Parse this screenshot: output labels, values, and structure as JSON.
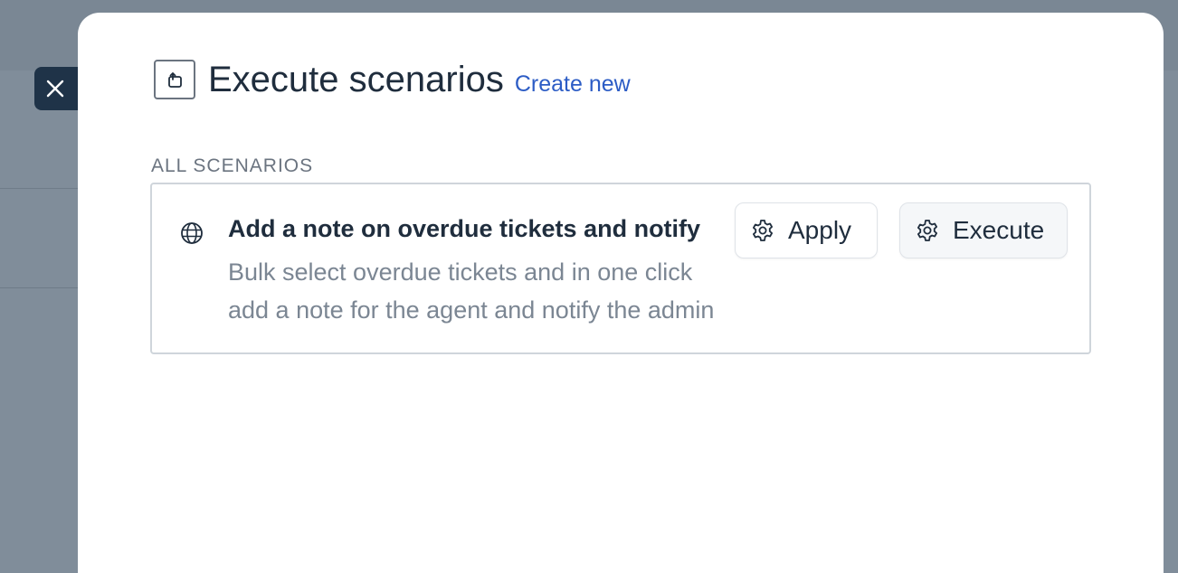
{
  "modal": {
    "title": "Execute scenarios",
    "create_new_label": "Create new",
    "section_label": "ALL SCENARIOS"
  },
  "scenarios": [
    {
      "title": "Add a note on overdue tickets and notify",
      "description": "Bulk select overdue tickets and in one click add a note for the agent and notify the admin as well",
      "apply_label": "Apply",
      "execute_label": "Execute"
    }
  ],
  "icons": {
    "close": "close-icon",
    "header": "scenario-automation-icon",
    "scope": "globe-icon",
    "apply": "gear-icon",
    "execute": "gear-icon"
  },
  "colors": {
    "overlay": "#808d9a",
    "close_button": "#1f3348",
    "title_text": "#1f2d3d",
    "link": "#2c5cc5",
    "muted_text": "#7b8693",
    "card_border": "#cfd5db"
  }
}
